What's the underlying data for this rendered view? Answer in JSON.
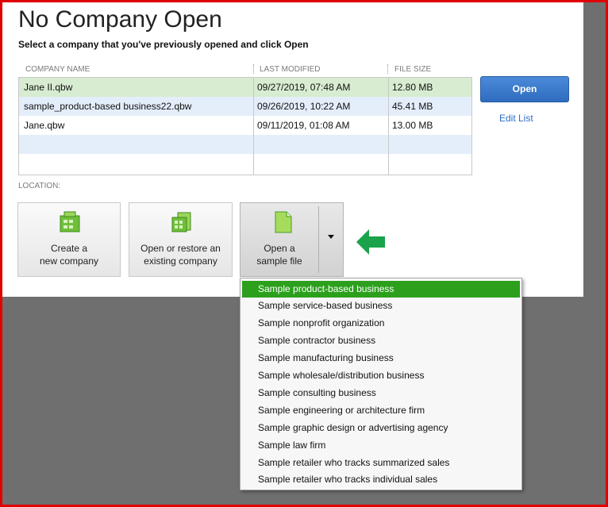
{
  "dialog": {
    "title": "No Company Open",
    "subtitle": "Select a company that you've previously opened and click Open"
  },
  "table": {
    "columns": [
      "COMPANY NAME",
      "LAST MODIFIED",
      "FILE SIZE"
    ],
    "rows": [
      {
        "name": "Jane II.qbw",
        "modified": "09/27/2019, 07:48 AM",
        "size": "12.80 MB"
      },
      {
        "name": "sample_product-based business22.qbw",
        "modified": "09/26/2019, 10:22 AM",
        "size": "45.41 MB"
      },
      {
        "name": "Jane.qbw",
        "modified": "09/11/2019, 01:08 AM",
        "size": "13.00 MB"
      }
    ]
  },
  "actions": {
    "open_label": "Open",
    "edit_list_label": "Edit List"
  },
  "location_label": "LOCATION:",
  "tiles": {
    "create": {
      "line1": "Create a",
      "line2": "new company"
    },
    "restore": {
      "line1": "Open or restore an",
      "line2": "existing company"
    },
    "sample": {
      "line1": "Open a",
      "line2": "sample file"
    }
  },
  "colors": {
    "accent_blue": "#2f6cc0",
    "selected_green": "#2ca01c",
    "row_highlight": "#d7ecd0",
    "row_stripe": "#e4eefb",
    "frame_red": "#e00000"
  },
  "sample_menu": {
    "items": [
      "Sample product-based business",
      "Sample service-based business",
      "Sample nonprofit organization",
      "Sample contractor business",
      "Sample manufacturing business",
      "Sample wholesale/distribution business",
      "Sample consulting business",
      "Sample engineering or architecture firm",
      "Sample graphic design or advertising agency",
      "Sample law firm",
      "Sample retailer who tracks summarized sales",
      "Sample retailer who tracks individual sales"
    ],
    "selected_index": 0
  }
}
